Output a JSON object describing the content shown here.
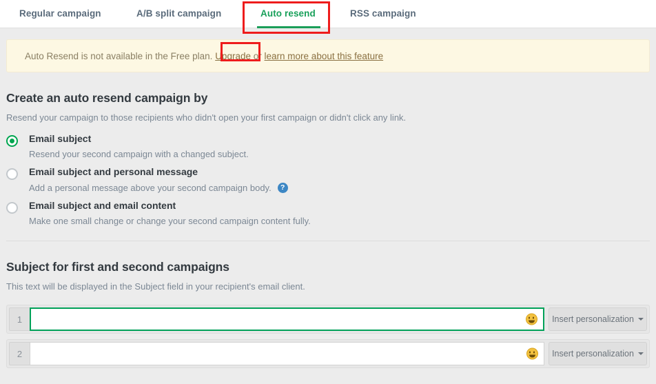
{
  "tabs": [
    {
      "label": "Regular campaign",
      "active": false
    },
    {
      "label": "A/B split campaign",
      "active": false
    },
    {
      "label": "Auto resend",
      "active": true
    },
    {
      "label": "RSS campaign",
      "active": false
    }
  ],
  "banner": {
    "message": "Auto Resend is not available in the Free plan.",
    "upgrade_link": "Upgrade",
    "conjunction": "or",
    "learn_link": "learn more about this feature"
  },
  "create_section": {
    "title": "Create an auto resend campaign by",
    "description": "Resend your campaign to those recipients who didn't open your first campaign or didn't click any link.",
    "options": [
      {
        "label": "Email subject",
        "description": "Resend your second campaign with a changed subject.",
        "selected": true,
        "help": false
      },
      {
        "label": "Email subject and personal message",
        "description": "Add a personal message above your second campaign body.",
        "selected": false,
        "help": true,
        "help_glyph": "?"
      },
      {
        "label": "Email subject and email content",
        "description": "Make one small change or change your second campaign content fully.",
        "selected": false,
        "help": false
      }
    ]
  },
  "subject_section": {
    "title": "Subject for first and second campaigns",
    "description": "This text will be displayed in the Subject field in your recipient's email client.",
    "rows": [
      {
        "number": "1",
        "value": "",
        "placeholder": "",
        "focused": true,
        "emoji_icon": "smiley-face-icon",
        "insert_label": "Insert personalization"
      },
      {
        "number": "2",
        "value": "",
        "placeholder": "",
        "focused": false,
        "emoji_icon": "smiley-face-icon",
        "insert_label": "Insert personalization"
      }
    ]
  },
  "colors": {
    "accent_green": "#00a650",
    "annotation_red": "#ee1c1c",
    "banner_bg": "#fdf8e3",
    "page_bg": "#ececec",
    "help_blue": "#3d87c4"
  }
}
